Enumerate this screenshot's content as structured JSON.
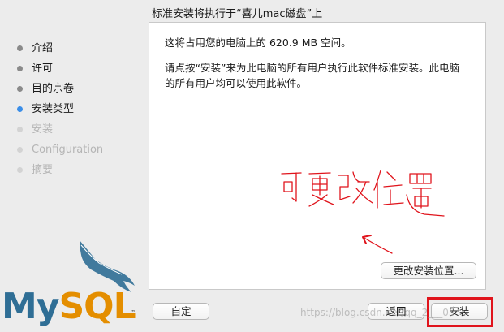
{
  "window": {
    "title": "标准安装将执行于“喜儿mac磁盘”上"
  },
  "sidebar": {
    "steps": [
      {
        "label": "介绍",
        "state": "done"
      },
      {
        "label": "许可",
        "state": "done"
      },
      {
        "label": "目的宗卷",
        "state": "done"
      },
      {
        "label": "安装类型",
        "state": "current"
      },
      {
        "label": "安装",
        "state": "pending"
      },
      {
        "label": "Configuration",
        "state": "pending"
      },
      {
        "label": "摘要",
        "state": "pending"
      }
    ],
    "logo": {
      "text_my": "My",
      "text_sql": "SQL",
      "trademark": "™"
    }
  },
  "content": {
    "space_message": "这将占用您的电脑上的 620.9 MB 空间。",
    "install_message": "请点按“安装”来为此电脑的所有用户执行此软件标准安装。此电脑的所有用户均可以使用此软件。",
    "change_location_label": "更改安装位置..."
  },
  "annotation": {
    "handwritten_text": "可更改位置",
    "color": "#e0141c"
  },
  "footer": {
    "customize_label": "自定",
    "back_label": "返回",
    "install_label": "安装",
    "watermark": "https://blog.csdn.net/qq_2___03"
  },
  "colors": {
    "current_step": "#3b8ee8",
    "mysql_blue": "#2f6e95",
    "mysql_orange": "#e48e00",
    "highlight_red": "#e0141c"
  }
}
